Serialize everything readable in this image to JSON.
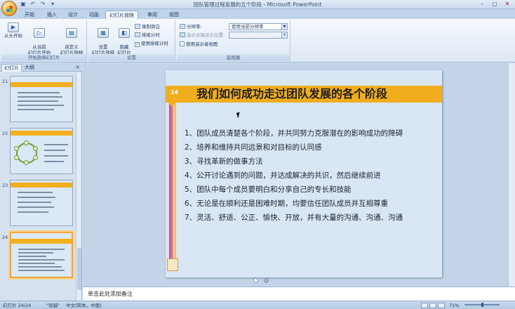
{
  "window": {
    "title": "团队管理过程发展的五个阶段 - Microsoft PowerPoint",
    "controls": [
      "–",
      "▢",
      "✕"
    ]
  },
  "ribbon_tabs": [
    {
      "label": "开始",
      "active": false
    },
    {
      "label": "插入",
      "active": false
    },
    {
      "label": "设计",
      "active": false
    },
    {
      "label": "动画",
      "active": false
    },
    {
      "label": "幻灯片放映",
      "active": true
    },
    {
      "label": "审阅",
      "active": false
    },
    {
      "label": "视图",
      "active": false
    }
  ],
  "ribbon": {
    "start_group": {
      "label": "开始放映幻灯片",
      "from_beginning": "从头开始",
      "from_current": "从当前\n幻灯片开始",
      "custom": "自定义\n幻灯片放映"
    },
    "setup_group": {
      "label": "设置",
      "setup": "设置\n幻灯片放映",
      "hide": "隐藏\n幻灯片",
      "record_narration": "录制旁白",
      "rehearse_timings": "排练计时",
      "use_timings": "使用排练计时"
    },
    "monitor_group": {
      "label": "监视器",
      "resolution_label": "分辨率:",
      "resolution_value": "使用当前分辨率",
      "show_on_label": "演示文稿显示位置:",
      "presenter_view": "使用演示者视图"
    }
  },
  "left_pane": {
    "tab_slides": "幻灯片",
    "tab_outline": "大纲",
    "close": "×",
    "thumbnails": [
      {
        "number": "21",
        "selected": false
      },
      {
        "number": "22",
        "selected": false
      },
      {
        "number": "23",
        "selected": false
      },
      {
        "number": "24",
        "selected": true
      }
    ]
  },
  "slide": {
    "number": "24",
    "title": "我们如何成功走过团队发展的各个阶段",
    "items": [
      "1、团队成员清楚各个阶段，并共同努力克服潜在的影响成功的障碍",
      "2、培养和维持共同远景和对目标的认同感",
      "3、寻找革新的做事方法",
      "4、公开讨论遇到的问题，并达成解决的共识，然后继续前进",
      "5、团队中每个成员要明白和分享自己的专长和技能",
      "6、无论是在顺利还是困难时期，均要信任团队成员并互相尊重",
      "7、灵活、舒适、公正、愉快、开放，并有大量的沟通、沟通、沟通"
    ]
  },
  "notes": {
    "placeholder": "单击此处添加备注"
  },
  "statusbar": {
    "slide_count": "幻灯片 24/24",
    "theme": "\"穿越\"",
    "language": "中文(简体，中国)",
    "zoom": "71%"
  }
}
